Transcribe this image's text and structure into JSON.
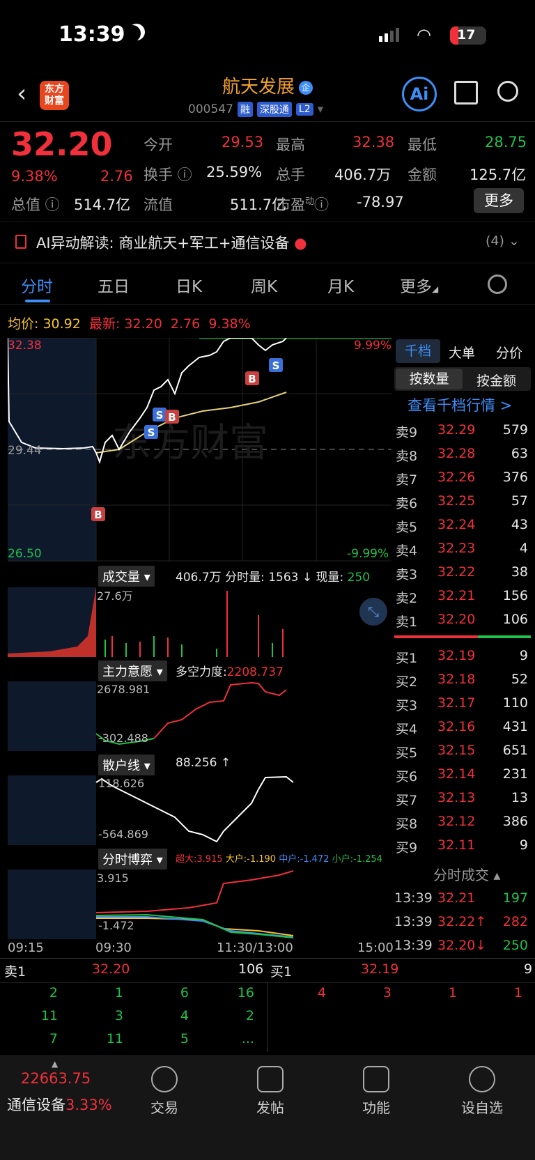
{
  "status": {
    "time": "13:39",
    "battery": "17"
  },
  "header": {
    "logo_line1": "东方",
    "logo_line2": "财富",
    "title": "航天发展",
    "code": "000547",
    "tags": [
      "融",
      "深股通",
      "L2"
    ],
    "ai_label": "Ai"
  },
  "quote": {
    "price": "32.20",
    "pct": "9.38%",
    "change": "2.76",
    "open_label": "今开",
    "open": "29.53",
    "high_label": "最高",
    "high": "32.38",
    "low_label": "最低",
    "low": "28.75",
    "turnover_label": "换手",
    "turnover": "25.59%",
    "vol_label": "总手",
    "vol": "406.7万",
    "amt_label": "金额",
    "amt": "125.7亿",
    "mcap_label": "总值",
    "mcap": "514.7亿",
    "float_label": "流值",
    "float": "511.7亿",
    "pe_label": "市盈",
    "pe_sup": "动",
    "pe": "-78.97",
    "more": "更多"
  },
  "ai_bar": {
    "label": "AI异动解读:",
    "text": "商业航天+军工+通信设备",
    "count": "(4)"
  },
  "tabs": [
    "分时",
    "五日",
    "日K",
    "周K",
    "月K",
    "更多"
  ],
  "info_line": {
    "avg_label": "均价:",
    "avg": "30.92",
    "new_label": "最新:",
    "new": "32.20",
    "chg": "2.76",
    "pct": "9.38%"
  },
  "chart": {
    "top": "32.38",
    "mid": "29.44",
    "bottom": "26.50",
    "pct_up": "9.99%",
    "pct_down": "-9.99%",
    "times": [
      "09:15",
      "09:30",
      "11:30/13:00",
      "15:00"
    ]
  },
  "vol_panel": {
    "label": "成交量",
    "total": "406.7万",
    "info": "分时量: 1563 ↓ 现量:",
    "now": "250",
    "max": "27.6万"
  },
  "main_panel": {
    "label": "主力意愿",
    "info": "多空力度:",
    "val": "2208.737",
    "top": "2678.981",
    "bottom": "-302.488"
  },
  "retail_panel": {
    "label": "散户线",
    "info": "88.256 ↑",
    "top": "118.626",
    "bottom": "-564.869"
  },
  "game_panel": {
    "label": "分时博弈",
    "super": "超大:3.915",
    "big": "大户:-1.190",
    "mid": "中户:-1.472",
    "small": "小户:-1.254",
    "top": "3.915",
    "bottom": "-1.472"
  },
  "book_tabs": [
    "千档",
    "大单",
    "分价"
  ],
  "book_sub": [
    "按数量",
    "按金额"
  ],
  "book_link": "查看千档行情 >",
  "asks": [
    [
      "卖9",
      "32.29",
      "579"
    ],
    [
      "卖8",
      "32.28",
      "63"
    ],
    [
      "卖7",
      "32.26",
      "376"
    ],
    [
      "卖6",
      "32.25",
      "57"
    ],
    [
      "卖5",
      "32.24",
      "43"
    ],
    [
      "卖4",
      "32.23",
      "4"
    ],
    [
      "卖3",
      "32.22",
      "38"
    ],
    [
      "卖2",
      "32.21",
      "156"
    ],
    [
      "卖1",
      "32.20",
      "106"
    ]
  ],
  "bids": [
    [
      "买1",
      "32.19",
      "9"
    ],
    [
      "买2",
      "32.18",
      "52"
    ],
    [
      "买3",
      "32.17",
      "110"
    ],
    [
      "买4",
      "32.16",
      "431"
    ],
    [
      "买5",
      "32.15",
      "651"
    ],
    [
      "买6",
      "32.14",
      "231"
    ],
    [
      "买7",
      "32.13",
      "13"
    ],
    [
      "买8",
      "32.12",
      "386"
    ],
    [
      "买9",
      "32.11",
      "9"
    ]
  ],
  "trades_title": "分时成交",
  "trades": [
    [
      "13:39",
      "32.21",
      "197"
    ],
    [
      "13:39",
      "32.22↑",
      "282"
    ],
    [
      "13:39",
      "32.20↓",
      "250"
    ]
  ],
  "l1": {
    "sell_label": "卖1",
    "sell_price": "32.20",
    "sell_qty": "106",
    "buy_label": "买1",
    "buy_price": "32.19",
    "buy_qty": "9"
  },
  "l1_sell_grid": [
    [
      "2",
      "1",
      "6",
      "16"
    ],
    [
      "11",
      "3",
      "4",
      "2"
    ],
    [
      "7",
      "11",
      "5",
      "..."
    ]
  ],
  "l1_buy_grid": [
    [
      "4",
      "3",
      "1",
      "1"
    ]
  ],
  "tabbar": {
    "index_value": "22663.75",
    "index_name": "通信设备",
    "index_pct": "3.33%",
    "items": [
      "交易",
      "发帖",
      "功能",
      "设自选"
    ]
  }
}
